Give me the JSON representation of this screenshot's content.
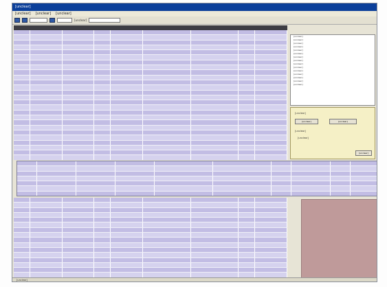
{
  "window": {
    "title": "[unclear]"
  },
  "menu": [
    {
      "label": "[unclear]"
    },
    {
      "label": "[unclear]"
    },
    {
      "label": "[unclear]"
    }
  ],
  "toolbar": {
    "field1_placeholder": "",
    "field2_placeholder": "",
    "label": "[unclear]"
  },
  "grid": {
    "rows": 26,
    "row_text": ""
  },
  "sidebar_list": {
    "items": [
      "[unclear]",
      "[unclear]",
      "[unclear]",
      "[unclear]",
      "[unclear]",
      "[unclear]",
      "[unclear]",
      "[unclear]",
      "[unclear]",
      "[unclear]",
      "[unclear]",
      "[unclear]",
      "[unclear]",
      "[unclear]",
      "[unclear]"
    ]
  },
  "settings": {
    "label_1": "[unclear]",
    "btn_1": "[unclear]",
    "btn_2": "[unclear]",
    "label_2": "[unclear]",
    "note": "[unclear]",
    "ok": "[unclear]"
  },
  "statusbar": {
    "text": "[unclear]"
  }
}
